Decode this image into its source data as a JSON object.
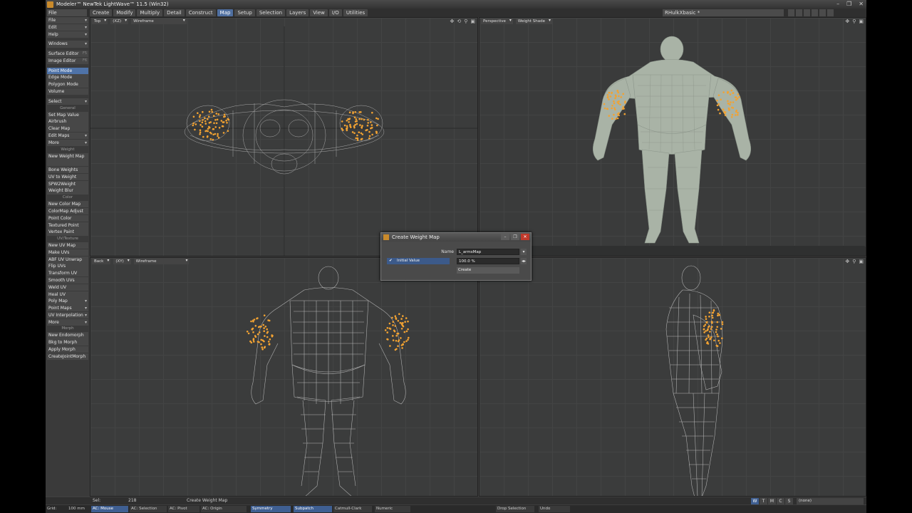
{
  "window": {
    "title": "Modeler™ NewTek LightWave™ 11.5 (Win32)"
  },
  "menu": {
    "sidebar_dropdown": "File",
    "tabs": [
      "Create",
      "Modify",
      "Multiply",
      "Detail",
      "Construct",
      "Map",
      "Setup",
      "Selection",
      "Layers",
      "View",
      "I/O",
      "Utilities"
    ],
    "active_tab": "Map",
    "scene_select": "RHulkXbasic *"
  },
  "sidebar": {
    "top": [
      {
        "label": "File",
        "drop": true
      },
      {
        "label": "Edit",
        "drop": true
      },
      {
        "label": "Help",
        "drop": true
      }
    ],
    "windows": {
      "label": "Windows",
      "drop": true
    },
    "editors": [
      {
        "label": "Surface Editor",
        "sc": "F5"
      },
      {
        "label": "Image Editor",
        "sc": "F6"
      }
    ],
    "modes": [
      {
        "label": "Point Mode",
        "active": true
      },
      {
        "label": "Edge Mode"
      },
      {
        "label": "Polygon Mode"
      },
      {
        "label": "Volume"
      }
    ],
    "select": {
      "label": "Select",
      "drop": true
    },
    "general_head": "General",
    "general": [
      {
        "label": "Set Map Value"
      },
      {
        "label": "Airbrush"
      },
      {
        "label": "Clear Map"
      },
      {
        "label": "Edit Maps",
        "drop": true
      },
      {
        "label": "More",
        "drop": true
      }
    ],
    "weight_head": "Weight",
    "weight": [
      {
        "label": "New Weight Map"
      },
      {
        "label": ""
      },
      {
        "label": "Bone Weights"
      },
      {
        "label": "UV to Weight"
      },
      {
        "label": "SPW2Weight"
      },
      {
        "label": "Weight Blur"
      }
    ],
    "color_head": "Color",
    "color": [
      {
        "label": "New Color Map"
      },
      {
        "label": "ColorMap Adjust"
      },
      {
        "label": "Point Color"
      },
      {
        "label": "Textured Point"
      },
      {
        "label": "Vertex Paint"
      }
    ],
    "uv_head": "UV/Texture",
    "uv": [
      {
        "label": "New UV Map"
      },
      {
        "label": "Make UVs"
      },
      {
        "label": "ABF UV Unwrap"
      },
      {
        "label": "Flip UVs"
      },
      {
        "label": "Transform UV"
      },
      {
        "label": "Smooth UVs"
      },
      {
        "label": "Weld UV"
      },
      {
        "label": "Heal UV"
      },
      {
        "label": "Poly Map",
        "drop": true
      },
      {
        "label": "Point Maps",
        "drop": true
      },
      {
        "label": "UV Interpolation",
        "drop": true
      },
      {
        "label": "More",
        "drop": true
      }
    ],
    "morph_head": "Morph",
    "morph": [
      {
        "label": "New Endomorph"
      },
      {
        "label": "Bkg to Morph"
      },
      {
        "label": "Apply Morph"
      },
      {
        "label": "CreateJointMorph"
      }
    ]
  },
  "viewports": {
    "top_left": {
      "view": "Top",
      "axis": "(XZ)",
      "mode": "Wireframe"
    },
    "top_right": {
      "view": "Perspective",
      "mode": "Weight Shade"
    },
    "bottom_left": {
      "view": "Back",
      "axis": "(XY)",
      "mode": "Wireframe"
    },
    "bottom_right": {
      "view": "",
      "mode": ""
    }
  },
  "dialog": {
    "title": "Create Weight Map",
    "name_label": "Name",
    "name_value": "L_armsMap",
    "initial_value_label": "Initial Value",
    "initial_value": "100.0 %",
    "create_label": "Create"
  },
  "status": {
    "sel_label": "Sel:",
    "sel_count": "218",
    "message": "Create Weight Map",
    "grid_label": "Grid:",
    "grid_value": "100 mm"
  },
  "bottombar": [
    {
      "label": "AC: Mouse",
      "on": true
    },
    {
      "label": "AC: Selection"
    },
    {
      "label": "AC: Pivot"
    },
    {
      "label": "AC: Origin"
    },
    {
      "label": "Symmetry",
      "on": true
    },
    {
      "label": "Subpatch",
      "on": true
    },
    {
      "label": "Catmull-Clark"
    },
    {
      "label": "Numeric"
    },
    {
      "label": "Drop Selection"
    },
    {
      "label": "Undo"
    }
  ],
  "vmap_buttons": {
    "labels": [
      "W",
      "T",
      "M",
      "C",
      "S"
    ],
    "active": "W"
  },
  "vmap_select": "(none)",
  "colors": {
    "accent": "#4f73a8",
    "weight_points": "#f0a030",
    "mesh": "#c8c8c8"
  }
}
